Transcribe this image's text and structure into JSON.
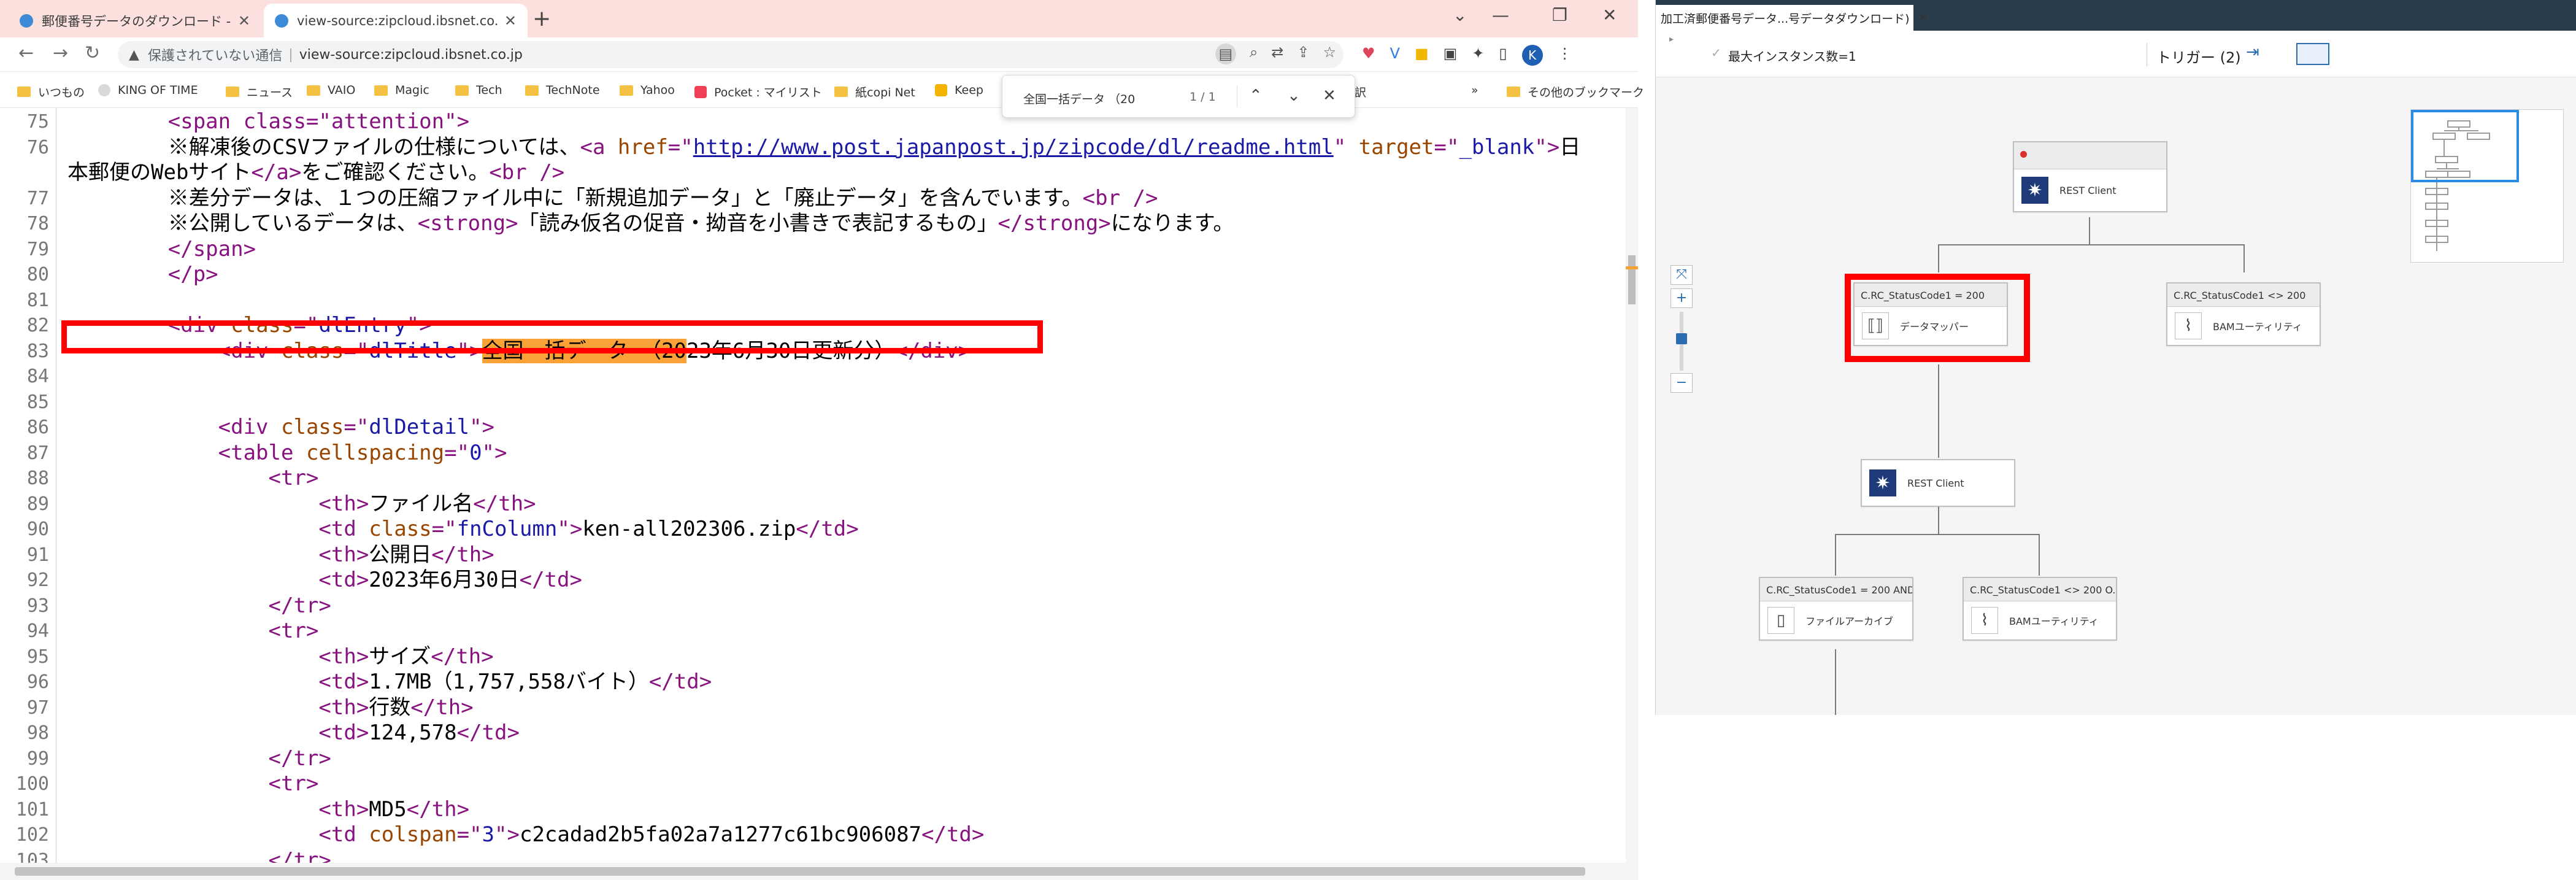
{
  "browser": {
    "tabs": [
      {
        "title": "郵便番号データのダウンロード - zipclo",
        "active": false
      },
      {
        "title": "view-source:zipcloud.ibsnet.co.jp",
        "active": true
      }
    ],
    "window_controls": {
      "chevron": "⌄",
      "minimize": "—",
      "restore": "❐",
      "close": "✕"
    },
    "address": {
      "insecure_label": "保護されていない通信",
      "separator": "|",
      "url": "view-source:zipcloud.ibsnet.co.jp"
    },
    "bookmarks": [
      {
        "label": "いつもの",
        "icon": "folder"
      },
      {
        "label": "KING OF TIME",
        "icon": "kot"
      },
      {
        "label": "ニュース",
        "icon": "folder"
      },
      {
        "label": "VAIO",
        "icon": "folder"
      },
      {
        "label": "Magic",
        "icon": "folder"
      },
      {
        "label": "Tech",
        "icon": "folder"
      },
      {
        "label": "TechNote",
        "icon": "folder"
      },
      {
        "label": "Yahoo",
        "icon": "folder"
      },
      {
        "label": "Pocket : マイリスト",
        "icon": "pocket"
      },
      {
        "label": "紙copi Net",
        "icon": "folder"
      },
      {
        "label": "Keep",
        "icon": "keep"
      },
      {
        "label": "訳",
        "icon": "none"
      },
      {
        "label": "»",
        "icon": "none"
      },
      {
        "label": "その他のブックマーク",
        "icon": "folder"
      }
    ],
    "find": {
      "query": "全国一括データ （20",
      "count": "1 / 1"
    },
    "profile_initial": "K"
  },
  "source": {
    "line_numbers": [
      "75",
      "76",
      "",
      "77",
      "78",
      "79",
      "80",
      "81",
      "82",
      "83",
      "84",
      "85",
      "86",
      "87",
      "88",
      "89",
      "90",
      "91",
      "92",
      "93",
      "94",
      "95",
      "96",
      "97",
      "98",
      "99",
      "100",
      "101",
      "102",
      "103"
    ],
    "lines": [
      {
        "indent": "        ",
        "parts": [
          [
            "tag",
            "<span class=\"attention\">"
          ]
        ]
      },
      {
        "indent": "        ",
        "parts": [
          [
            "txt",
            "※解凍後のCSVファイルの仕様については、"
          ],
          [
            "tag",
            "<a "
          ],
          [
            "attr",
            "href"
          ],
          [
            "tag",
            "=\""
          ],
          [
            "link",
            "http://www.post.japanpost.jp/zipcode/dl/readme.html"
          ],
          [
            "tag",
            "\" "
          ],
          [
            "attr",
            "target"
          ],
          [
            "tag",
            "=\""
          ],
          [
            "val",
            "_blank"
          ],
          [
            "tag",
            "\">"
          ],
          [
            "txt",
            "日"
          ]
        ]
      },
      {
        "indent": "",
        "parts": [
          [
            "txt",
            "本郵便のWebサイト"
          ],
          [
            "tag",
            "</a>"
          ],
          [
            "txt",
            "をご確認ください。"
          ],
          [
            "tag",
            "<br />"
          ]
        ]
      },
      {
        "indent": "        ",
        "parts": [
          [
            "txt",
            "※差分データは、１つの圧縮ファイル中に「新規追加データ」と「廃止データ」を含んでいます。"
          ],
          [
            "tag",
            "<br />"
          ]
        ]
      },
      {
        "indent": "        ",
        "parts": [
          [
            "txt",
            "※公開しているデータは、"
          ],
          [
            "tag",
            "<strong>"
          ],
          [
            "txt",
            "「読み仮名の促音・拗音を小書きで表記するもの」"
          ],
          [
            "tag",
            "</strong>"
          ],
          [
            "txt",
            "になります。"
          ]
        ]
      },
      {
        "indent": "        ",
        "parts": [
          [
            "tag",
            "</span>"
          ]
        ]
      },
      {
        "indent": "        ",
        "parts": [
          [
            "tag",
            "</p>"
          ]
        ]
      },
      {
        "indent": "",
        "parts": []
      },
      {
        "indent": "        ",
        "parts": [
          [
            "tag",
            "<div "
          ],
          [
            "attr",
            "class"
          ],
          [
            "tag",
            "=\""
          ],
          [
            "val",
            "dlEntry"
          ],
          [
            "tag",
            "\">"
          ]
        ]
      },
      {
        "indent": "            ",
        "parts": [
          [
            "tag",
            "<div "
          ],
          [
            "attr",
            "class"
          ],
          [
            "tag",
            "=\""
          ],
          [
            "val",
            "dlTitle"
          ],
          [
            "tag",
            "\">"
          ],
          [
            "find",
            "全国一括データ （20"
          ],
          [
            "txt",
            "23年6月30日更新分）"
          ],
          [
            "tag",
            "</div>"
          ]
        ]
      },
      {
        "indent": "",
        "parts": []
      },
      {
        "indent": "",
        "parts": []
      },
      {
        "indent": "            ",
        "parts": [
          [
            "tag",
            "<div "
          ],
          [
            "attr",
            "class"
          ],
          [
            "tag",
            "=\""
          ],
          [
            "val",
            "dlDetail"
          ],
          [
            "tag",
            "\">"
          ]
        ]
      },
      {
        "indent": "            ",
        "parts": [
          [
            "tag",
            "<table "
          ],
          [
            "attr",
            "cellspacing"
          ],
          [
            "tag",
            "=\""
          ],
          [
            "val",
            "0"
          ],
          [
            "tag",
            "\">"
          ]
        ]
      },
      {
        "indent": "                ",
        "parts": [
          [
            "tag",
            "<tr>"
          ]
        ]
      },
      {
        "indent": "                    ",
        "parts": [
          [
            "tag",
            "<th>"
          ],
          [
            "txt",
            "ファイル名"
          ],
          [
            "tag",
            "</th>"
          ]
        ]
      },
      {
        "indent": "                    ",
        "parts": [
          [
            "tag",
            "<td "
          ],
          [
            "attr",
            "class"
          ],
          [
            "tag",
            "=\""
          ],
          [
            "val",
            "fnColumn"
          ],
          [
            "tag",
            "\">"
          ],
          [
            "txt",
            "ken-all202306.zip"
          ],
          [
            "tag",
            "</td>"
          ]
        ]
      },
      {
        "indent": "                    ",
        "parts": [
          [
            "tag",
            "<th>"
          ],
          [
            "txt",
            "公開日"
          ],
          [
            "tag",
            "</th>"
          ]
        ]
      },
      {
        "indent": "                    ",
        "parts": [
          [
            "tag",
            "<td>"
          ],
          [
            "txt",
            "2023年6月30日"
          ],
          [
            "tag",
            "</td>"
          ]
        ]
      },
      {
        "indent": "                ",
        "parts": [
          [
            "tag",
            "</tr>"
          ]
        ]
      },
      {
        "indent": "                ",
        "parts": [
          [
            "tag",
            "<tr>"
          ]
        ]
      },
      {
        "indent": "                    ",
        "parts": [
          [
            "tag",
            "<th>"
          ],
          [
            "txt",
            "サイズ"
          ],
          [
            "tag",
            "</th>"
          ]
        ]
      },
      {
        "indent": "                    ",
        "parts": [
          [
            "tag",
            "<td>"
          ],
          [
            "txt",
            "1.7MB（1,757,558バイト）"
          ],
          [
            "tag",
            "</td>"
          ]
        ]
      },
      {
        "indent": "                    ",
        "parts": [
          [
            "tag",
            "<th>"
          ],
          [
            "txt",
            "行数"
          ],
          [
            "tag",
            "</th>"
          ]
        ]
      },
      {
        "indent": "                    ",
        "parts": [
          [
            "tag",
            "<td>"
          ],
          [
            "txt",
            "124,578"
          ],
          [
            "tag",
            "</td>"
          ]
        ]
      },
      {
        "indent": "                ",
        "parts": [
          [
            "tag",
            "</tr>"
          ]
        ]
      },
      {
        "indent": "                ",
        "parts": [
          [
            "tag",
            "<tr>"
          ]
        ]
      },
      {
        "indent": "                    ",
        "parts": [
          [
            "tag",
            "<th>"
          ],
          [
            "txt",
            "MD5"
          ],
          [
            "tag",
            "</th>"
          ]
        ]
      },
      {
        "indent": "                    ",
        "parts": [
          [
            "tag",
            "<td "
          ],
          [
            "attr",
            "colspan"
          ],
          [
            "tag",
            "=\""
          ],
          [
            "val",
            "3"
          ],
          [
            "tag",
            "\">"
          ],
          [
            "txt",
            "c2cadad2b5fa02a7a1277c61bc906087"
          ],
          [
            "tag",
            "</td>"
          ]
        ]
      },
      {
        "indent": "                ",
        "parts": [
          [
            "tag",
            "</tr>"
          ]
        ]
      }
    ]
  },
  "designer": {
    "tab_title": "加工済郵便番号データ...号データダウンロード)",
    "max_instances": "最大インスタンス数=1",
    "trigger": "トリガー (2)",
    "nodes": {
      "rest1": {
        "label": "REST Client"
      },
      "mapper": {
        "header": "C.RC_StatusCode1 = 200",
        "label": "データマッパー"
      },
      "bam1": {
        "header": "C.RC_StatusCode1 <> 200",
        "label": "BAMユーティリティ"
      },
      "rest2": {
        "label": "REST Client"
      },
      "archive": {
        "header": "C.RC_StatusCode1 = 200 AND...",
        "label": "ファイルアーカイブ"
      },
      "bam2": {
        "header": "C.RC_StatusCode1 <> 200 O...",
        "label": "BAMユーティリティ"
      }
    },
    "zoom_level": 0.55
  },
  "colors": {
    "highlight_red": "#ff0000",
    "find_match": "#f9a238",
    "tag": "#881280",
    "attr": "#994500",
    "value": "#1a1aa6",
    "rest_icon": "#1e3a78",
    "accent": "#2a6db0"
  }
}
